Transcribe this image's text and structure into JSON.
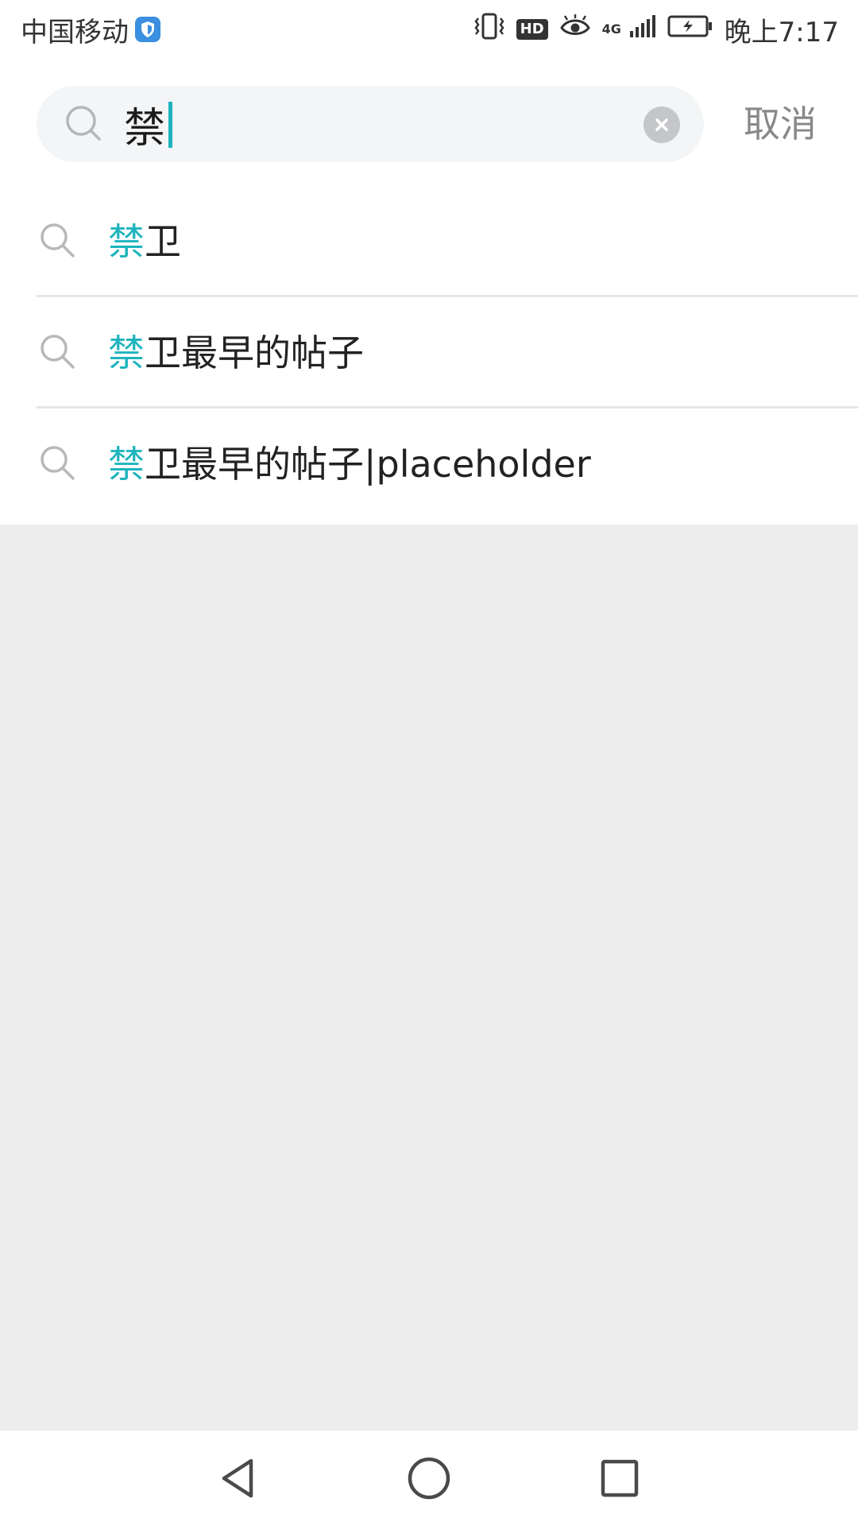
{
  "status_bar": {
    "carrier": "中国移动",
    "hd": "HD",
    "network": "4G",
    "time": "晚上7:17",
    "icons": [
      "shield-icon",
      "vibrate-icon",
      "eye-icon",
      "signal-icon",
      "battery-charging-icon"
    ]
  },
  "search": {
    "value": "禁",
    "placeholder": "",
    "cancel_label": "取消"
  },
  "suggestions": [
    {
      "highlight": "禁",
      "rest": "卫"
    },
    {
      "highlight": "禁",
      "rest": "卫最早的帖子"
    },
    {
      "highlight": "禁",
      "rest": "卫最早的帖子|placeholder"
    }
  ],
  "colors": {
    "accent": "#1fb4bd",
    "text": "#222222",
    "cancel": "#888888",
    "page_background": "#ededed",
    "search_background": "#f4f5f7"
  },
  "navigation": {
    "icons": [
      "back-icon",
      "home-icon",
      "recents-icon"
    ]
  }
}
